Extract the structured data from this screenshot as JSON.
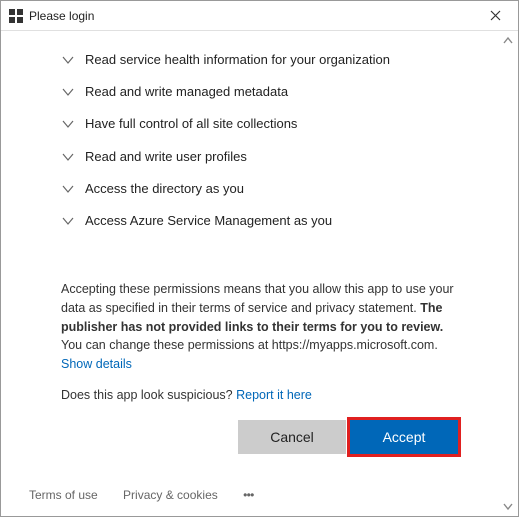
{
  "window": {
    "title": "Please login"
  },
  "permissions": [
    {
      "label": "Read service health information for your organization"
    },
    {
      "label": "Read and write managed metadata"
    },
    {
      "label": "Have full control of all site collections"
    },
    {
      "label": "Read and write user profiles"
    },
    {
      "label": "Access the directory as you"
    },
    {
      "label": "Access Azure Service Management as you"
    }
  ],
  "disclaimer": {
    "part1": "Accepting these permissions means that you allow this app to use your data as specified in their terms of service and privacy statement. ",
    "bold": "The publisher has not provided links to their terms for you to review.",
    "part2": " You can change these permissions at https://myapps.microsoft.com. ",
    "show_details": "Show details"
  },
  "report": {
    "question": "Does this app look suspicious? ",
    "link": "Report it here"
  },
  "buttons": {
    "cancel": "Cancel",
    "accept": "Accept"
  },
  "footer": {
    "terms": "Terms of use",
    "privacy": "Privacy & cookies",
    "more": "• • •"
  }
}
